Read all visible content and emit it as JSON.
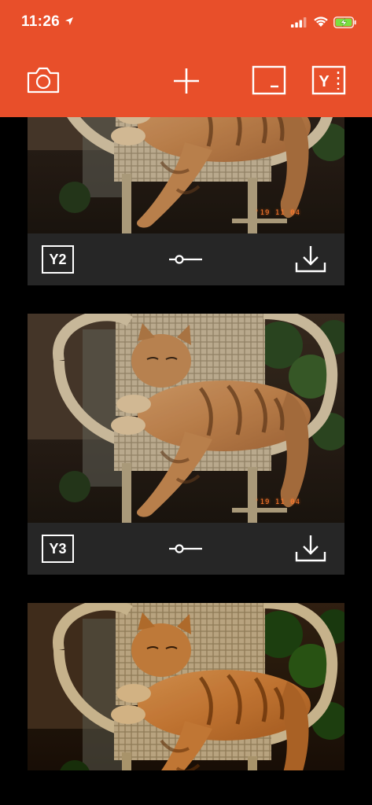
{
  "status_bar": {
    "time": "11:26",
    "icons": [
      "location-arrow-icon",
      "cellular-signal-icon",
      "wifi-icon",
      "battery-charging-icon"
    ]
  },
  "toolbar": {
    "icons": [
      "camera-icon",
      "plus-icon",
      "frame-icon",
      "y-logo-icon"
    ],
    "y_label": "Y"
  },
  "colors": {
    "header": "#e84f2a",
    "background": "#000000",
    "controls": "#262626",
    "battery": "#7ae040",
    "datestamp": "#ff7a2e"
  },
  "feed": {
    "cards": [
      {
        "badge": "Y2",
        "date_stamp": "'19 11 04"
      },
      {
        "badge": "Y3",
        "date_stamp": "'19 11 04"
      },
      {
        "badge": "",
        "date_stamp": ""
      }
    ]
  }
}
